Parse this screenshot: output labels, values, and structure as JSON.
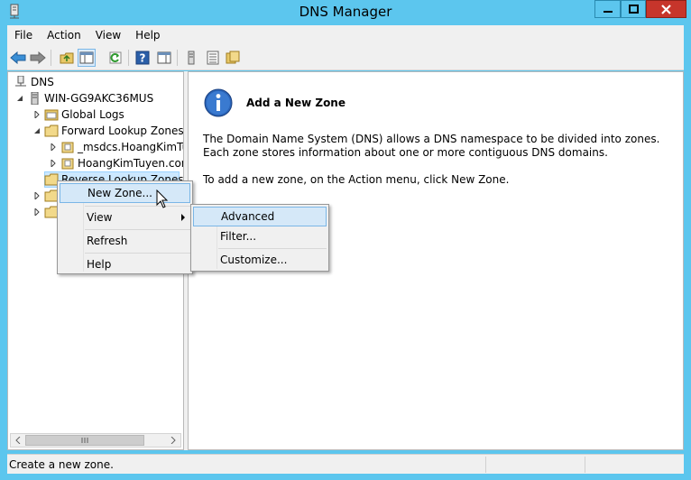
{
  "window": {
    "title": "DNS Manager",
    "controls": {
      "minimize": "minimize-icon",
      "maximize": "maximize-icon",
      "close": "close-icon"
    }
  },
  "menubar": {
    "items": [
      "File",
      "Action",
      "View",
      "Help"
    ]
  },
  "toolbar": {
    "icons": [
      "back-arrow-icon",
      "forward-arrow-icon",
      "up-folder-icon",
      "show-hide-console-tree-icon",
      "refresh-icon",
      "help-icon",
      "show-hide-action-pane-icon",
      "server-icon",
      "list-icon",
      "folder-icon"
    ]
  },
  "tree": {
    "root": "DNS",
    "server": "WIN-GG9AKC36MUS",
    "global_logs": "Global Logs",
    "forward_zones": "Forward Lookup Zones",
    "zone1": "_msdcs.HoangKimTu",
    "zone2": "HoangKimTuyen.cor",
    "reverse_zones": "Reverse Lookup Zones"
  },
  "context_menu": {
    "new_zone": "New Zone...",
    "view": "View",
    "refresh": "Refresh",
    "help": "Help"
  },
  "submenu": {
    "advanced": "Advanced",
    "filter": "Filter...",
    "customize": "Customize..."
  },
  "result": {
    "heading": "Add a New Zone",
    "paragraph1": "The Domain Name System (DNS) allows a DNS namespace to be divided into zones. Each zone stores information about one or more contiguous DNS domains.",
    "paragraph2": "To add a new zone, on the Action menu, click New Zone."
  },
  "statusbar": {
    "text": "Create a new zone."
  },
  "colors": {
    "titlebar": "#5cc6ee",
    "close_button": "#c7352b",
    "highlight": "#d5e8f8",
    "highlight_border": "#7ab6e6"
  }
}
